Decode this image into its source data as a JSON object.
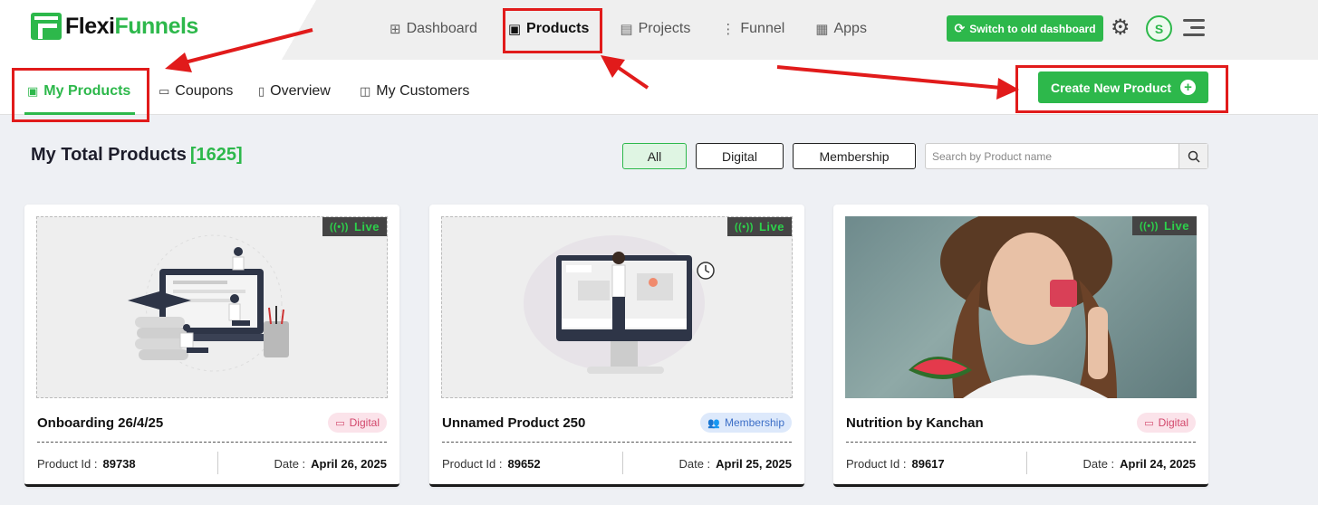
{
  "app": {
    "logo_part1": "Flexi",
    "logo_part2": "Funnels"
  },
  "nav": {
    "items": [
      {
        "label": "Dashboard",
        "icon": "dashboard-grid-icon"
      },
      {
        "label": "Products",
        "icon": "products-box-icon",
        "active": true
      },
      {
        "label": "Projects",
        "icon": "projects-doc-icon"
      },
      {
        "label": "Funnel",
        "icon": "funnel-icon"
      },
      {
        "label": "Apps",
        "icon": "apps-icon"
      }
    ],
    "switch_label": "Switch to old dashboard",
    "avatar_initial": "S"
  },
  "subnav": {
    "tabs": [
      {
        "label": "My Products",
        "active": true
      },
      {
        "label": "Coupons"
      },
      {
        "label": "Overview"
      },
      {
        "label": "My Customers"
      }
    ],
    "create_label": "Create New Product"
  },
  "main": {
    "title": "My Total Products",
    "count": "[1625]",
    "filters": [
      "All",
      "Digital",
      "Membership"
    ],
    "active_filter": "All",
    "search_placeholder": "Search by Product name"
  },
  "cards": [
    {
      "title": "Onboarding 26/4/25",
      "type": "Digital",
      "status": "Live",
      "id_label": "Product Id :",
      "id": "89738",
      "date_label": "Date :",
      "date": "April 26, 2025"
    },
    {
      "title": "Unnamed Product 250",
      "type": "Membership",
      "status": "Live",
      "id_label": "Product Id :",
      "id": "89652",
      "date_label": "Date :",
      "date": "April 25, 2025"
    },
    {
      "title": "Nutrition by Kanchan",
      "type": "Digital",
      "status": "Live",
      "id_label": "Product Id :",
      "id": "89617",
      "date_label": "Date :",
      "date": "April 24, 2025"
    }
  ],
  "colors": {
    "brand_green": "#2db84b",
    "annotation_red": "#e11b1b",
    "digital_badge": "#d2486c",
    "membership_badge": "#3d6fc7"
  }
}
